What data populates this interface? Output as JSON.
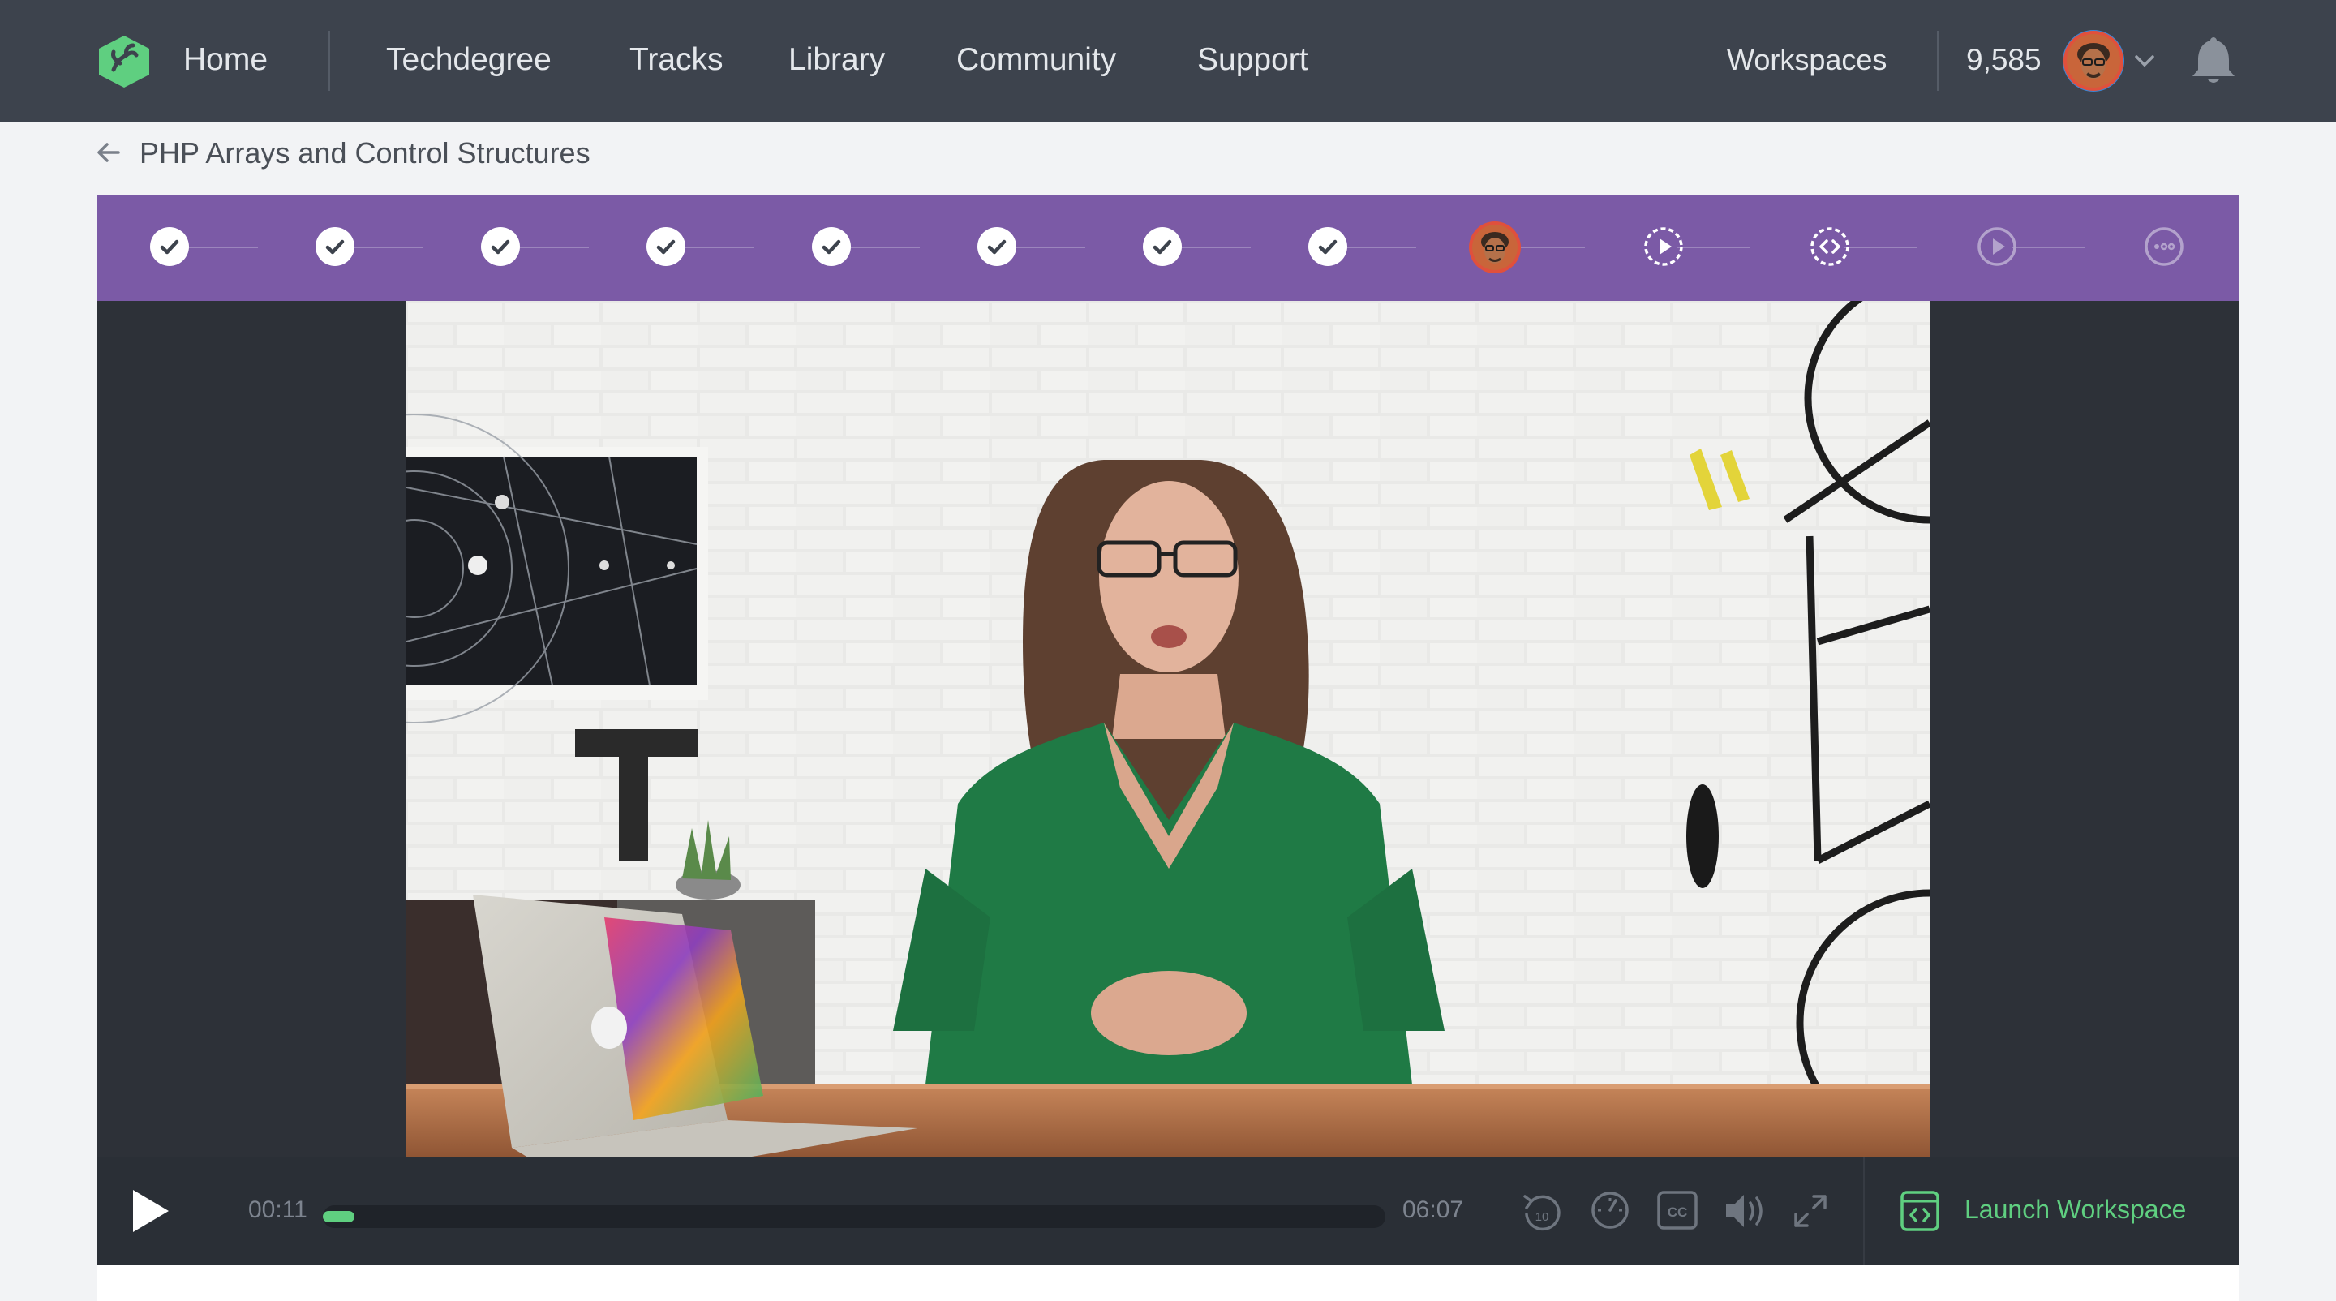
{
  "nav": {
    "home": "Home",
    "links": [
      "Techdegree",
      "Tracks",
      "Library",
      "Community",
      "Support"
    ],
    "workspaces": "Workspaces",
    "points": "9,585"
  },
  "breadcrumb": {
    "title": "PHP Arrays and Control Structures"
  },
  "steps": {
    "completed_count": 8,
    "current_index": 8,
    "upcoming": [
      "video-play-dashed-icon",
      "code-challenge-dashed-icon",
      "video-play-icon",
      "quiz-icon"
    ]
  },
  "player": {
    "current_time": "00:11",
    "duration": "06:07",
    "progress": 0.03,
    "skip_back_seconds": "10",
    "launch_label": "Launch Workspace"
  },
  "colors": {
    "nav_bg": "#3d434d",
    "step_bar": "#7b5aa6",
    "accent_green": "#5fcf80",
    "player_bg": "#2d3138"
  }
}
